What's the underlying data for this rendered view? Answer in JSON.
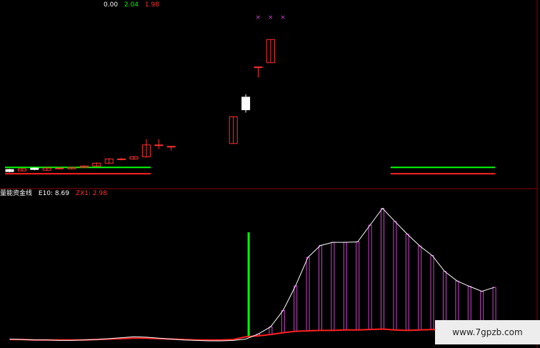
{
  "header": {
    "values": [
      {
        "text": "0.00",
        "color": "#ffffff"
      },
      {
        "text": "2.04",
        "color": "#00ff00"
      },
      {
        "text": "1.98",
        "color": "#ff3030"
      }
    ]
  },
  "indicator": {
    "name": "量能资金线",
    "e10": "E10: 8.69",
    "zx1": "ZX1: 2.98"
  },
  "watermark": "www.7gpzb.com",
  "colors": {
    "background": "#000000",
    "grid": "#8b0000",
    "up_candle": "#ff3030",
    "down_candle": "#ffffff",
    "green_line": "#00ff00",
    "red_line": "#ff2020",
    "white_line": "#ffffff",
    "histogram": "#cc44cc",
    "markers": "#cc44cc"
  },
  "chart_data": [
    {
      "type": "candlestick",
      "panel": "price",
      "candles": [
        {
          "o": 0.3,
          "c": 0.0,
          "h": 0.4,
          "l": -0.1
        },
        {
          "o": 0.1,
          "c": 0.4,
          "h": 0.5,
          "l": 0.0
        },
        {
          "o": 0.5,
          "c": 0.3,
          "h": 0.6,
          "l": 0.2
        },
        {
          "o": 0.2,
          "c": 0.5,
          "h": 0.6,
          "l": 0.1
        },
        {
          "o": 0.5,
          "c": 0.5,
          "h": 0.7,
          "l": 0.3
        },
        {
          "o": 0.4,
          "c": 0.6,
          "h": 0.7,
          "l": 0.3
        },
        {
          "o": 0.6,
          "c": 0.8,
          "h": 0.9,
          "l": 0.5
        },
        {
          "o": 0.8,
          "c": 1.2,
          "h": 1.3,
          "l": 0.7
        },
        {
          "o": 1.2,
          "c": 1.8,
          "h": 1.9,
          "l": 1.1
        },
        {
          "o": 1.8,
          "c": 1.8,
          "h": 2.0,
          "l": 1.6
        },
        {
          "o": 1.8,
          "c": 2.1,
          "h": 2.2,
          "l": 1.7
        },
        {
          "o": 2.1,
          "c": 3.8,
          "h": 4.6,
          "l": 2.0
        },
        {
          "o": 3.8,
          "c": 3.8,
          "h": 4.6,
          "l": 3.2
        },
        {
          "o": 3.6,
          "c": 3.6,
          "h": 3.6,
          "l": 3.0
        },
        null,
        null,
        null,
        null,
        {
          "o": 4.0,
          "c": 7.8,
          "h": 7.8,
          "l": 4.0
        },
        {
          "o": 10.6,
          "c": 8.8,
          "h": 11.0,
          "l": 8.4
        },
        {
          "o": 14.9,
          "c": 14.9,
          "h": 14.9,
          "l": 13.4
        },
        {
          "o": 15.5,
          "c": 18.8,
          "h": 18.8,
          "l": 15.5
        },
        null,
        null,
        null,
        null,
        null,
        null,
        null,
        null,
        null,
        null,
        null,
        null,
        null,
        null,
        null,
        null,
        null,
        null
      ],
      "green_level": 0.6,
      "red_level": -0.3,
      "markers_x": [
        20,
        21,
        22
      ],
      "ylim": [
        -1,
        23
      ]
    },
    {
      "type": "line",
      "panel": "indicator",
      "x": [
        0,
        1,
        2,
        3,
        4,
        5,
        6,
        7,
        8,
        9,
        10,
        11,
        12,
        13,
        14,
        15,
        16,
        17,
        18,
        19,
        20,
        21,
        22,
        23,
        24,
        25,
        26,
        27,
        28,
        29,
        30,
        31,
        32,
        33,
        34,
        35,
        36,
        37,
        38,
        39
      ],
      "series": [
        {
          "name": "E10",
          "values": [
            0.5,
            0.4,
            0.3,
            0.3,
            0.2,
            0.2,
            0.3,
            0.4,
            0.6,
            0.8,
            1.0,
            0.9,
            0.7,
            0.5,
            0.3,
            0.2,
            0.1,
            0.1,
            0.2,
            0.5,
            1.6,
            3.2,
            6.8,
            12.2,
            18.5,
            21.1,
            21.8,
            21.8,
            21.9,
            25.6,
            29.3,
            26.4,
            23.6,
            21.0,
            18.9,
            15.4,
            13.3,
            12.1,
            11.0,
            11.9
          ]
        },
        {
          "name": "ZX1",
          "values": [
            0.4,
            0.4,
            0.3,
            0.3,
            0.3,
            0.3,
            0.3,
            0.4,
            0.5,
            0.6,
            0.7,
            0.7,
            0.6,
            0.5,
            0.4,
            0.3,
            0.3,
            0.3,
            0.4,
            1.0,
            1.2,
            1.5,
            1.9,
            2.2,
            2.3,
            2.4,
            2.4,
            2.5,
            2.5,
            2.6,
            2.7,
            2.5,
            2.4,
            2.5,
            2.6,
            2.5,
            2.5,
            2.6,
            2.6,
            2.7
          ]
        }
      ],
      "histogram": {
        "name": "E10-ZX1",
        "from_index": 20,
        "to_index": 39
      },
      "green_bar": {
        "index": 19,
        "top": 24.0
      },
      "ylim": [
        -1,
        33
      ]
    }
  ]
}
